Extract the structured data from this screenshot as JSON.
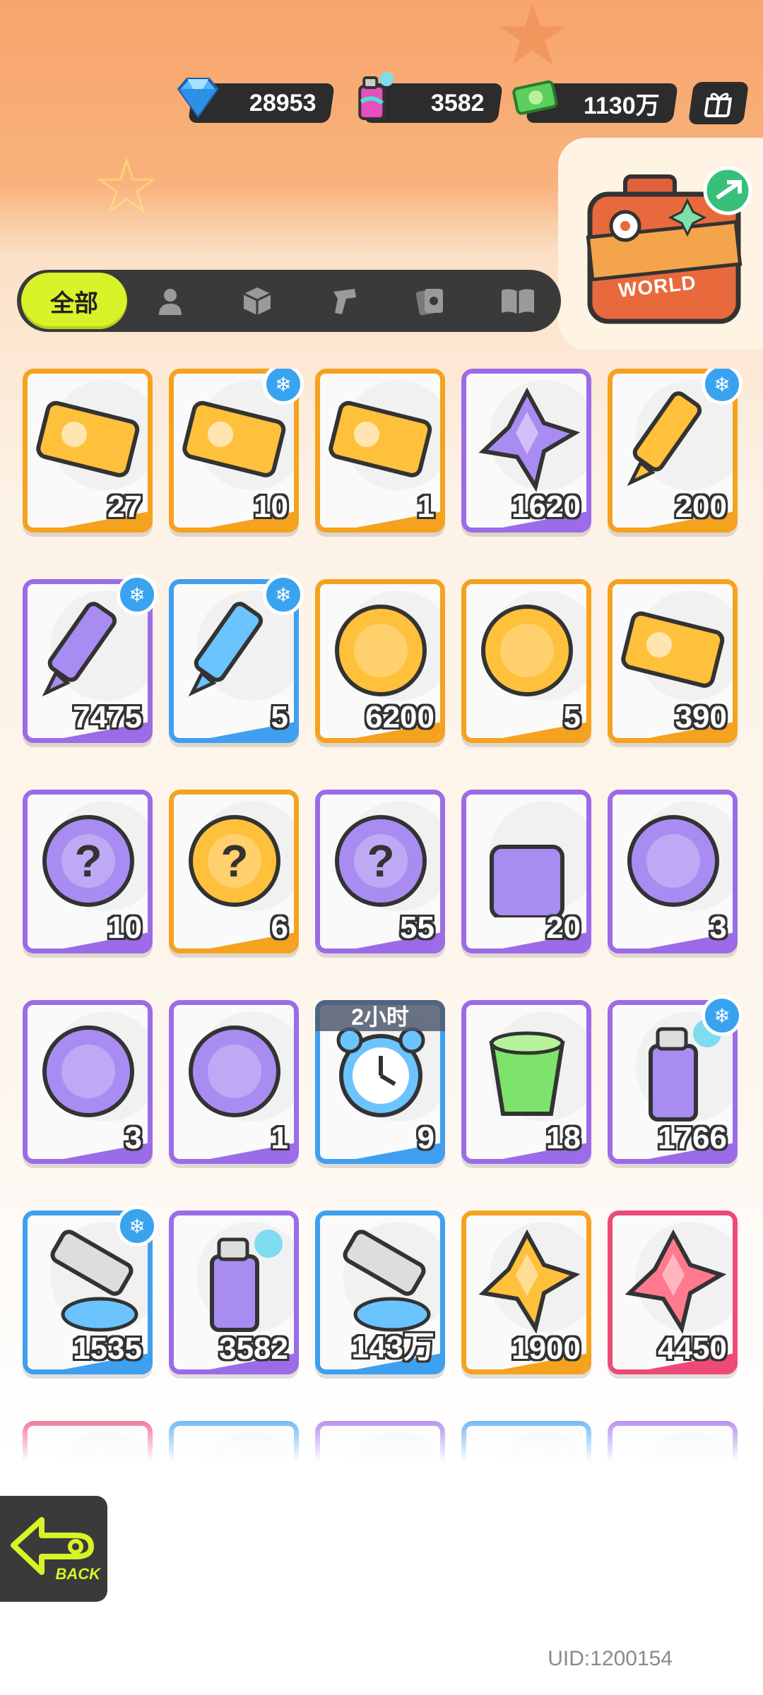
{
  "resources": {
    "diamond": {
      "icon": "diamond-icon",
      "value": "28953"
    },
    "spray": {
      "icon": "spray-can-icon",
      "value": "3582"
    },
    "cash": {
      "icon": "cash-icon",
      "value": "1130万"
    }
  },
  "suitcase": {
    "label": "WORLD"
  },
  "tabs": {
    "all_label": "全部",
    "icons": [
      "person-icon",
      "box-icon",
      "spray-gun-icon",
      "cards-icon",
      "book-icon"
    ]
  },
  "items": [
    {
      "icon": "gold-ticket-icon",
      "count": "27",
      "color": "orange",
      "badge": false
    },
    {
      "icon": "wave-up-ticket-icon",
      "count": "10",
      "color": "orange",
      "badge": true
    },
    {
      "icon": "purple-ticket-icon",
      "count": "1",
      "color": "orange",
      "badge": false
    },
    {
      "icon": "blue-star-crystal-icon",
      "count": "1620",
      "color": "purple",
      "badge": false
    },
    {
      "icon": "gold-crayon-icon",
      "count": "200",
      "color": "orange",
      "badge": true
    },
    {
      "icon": "purple-crayon-icon",
      "count": "7475",
      "color": "purple",
      "badge": true
    },
    {
      "icon": "blue-crayon-icon",
      "count": "5",
      "color": "blue",
      "badge": true
    },
    {
      "icon": "cool-sticker-icon",
      "count": "6200",
      "color": "orange",
      "badge": false
    },
    {
      "icon": "star-burst-sticker-icon",
      "count": "5",
      "color": "orange",
      "badge": false
    },
    {
      "icon": "season-ticket-icon",
      "count": "390",
      "color": "orange",
      "badge": false
    },
    {
      "icon": "mystery-egg-icon",
      "count": "10",
      "color": "purple",
      "badge": false
    },
    {
      "icon": "gold-mystery-badge-icon",
      "count": "6",
      "color": "orange",
      "badge": false
    },
    {
      "icon": "purple-mystery-badge-icon",
      "count": "55",
      "color": "purple",
      "badge": false
    },
    {
      "icon": "travel-card-mystery-icon",
      "count": "20",
      "color": "purple",
      "badge": false
    },
    {
      "icon": "red-fish-orb-icon",
      "count": "3",
      "color": "purple",
      "badge": false
    },
    {
      "icon": "yellow-creature-orb-icon",
      "count": "3",
      "color": "purple",
      "badge": false
    },
    {
      "icon": "green-sprout-orb-icon",
      "count": "1",
      "color": "purple",
      "badge": false
    },
    {
      "icon": "alarm-clock-icon",
      "count": "9",
      "color": "blue",
      "badge": false,
      "timer": "2小时"
    },
    {
      "icon": "green-drink-icon",
      "count": "18",
      "color": "purple",
      "badge": false
    },
    {
      "icon": "blue-spray-can-icon",
      "count": "1766",
      "color": "purple",
      "badge": true
    },
    {
      "icon": "rainbow-paint-tube-icon",
      "count": "1535",
      "color": "blue",
      "badge": true
    },
    {
      "icon": "pink-spray-can-icon",
      "count": "3582",
      "color": "purple",
      "badge": false
    },
    {
      "icon": "paint-tube-icon",
      "count": "143万",
      "color": "blue",
      "badge": false
    },
    {
      "icon": "gold-gem-icon",
      "count": "1900",
      "color": "orange",
      "badge": false
    },
    {
      "icon": "red-gem-icon",
      "count": "4450",
      "color": "pink",
      "badge": false
    },
    {
      "icon": "partial-item-icon",
      "count": "",
      "color": "pink",
      "badge": false
    },
    {
      "icon": "partial-item-icon",
      "count": "",
      "color": "blue",
      "badge": false
    },
    {
      "icon": "partial-item-icon",
      "count": "",
      "color": "purple",
      "badge": false
    },
    {
      "icon": "partial-item-icon",
      "count": "",
      "color": "blue",
      "badge": false
    },
    {
      "icon": "partial-item-icon",
      "count": "",
      "color": "purple",
      "badge": false
    }
  ],
  "back": {
    "label": "BACK"
  },
  "uid": "UID:1200154",
  "colors": {
    "accent": "#d8f327",
    "orange": "#f5a21f",
    "purple": "#9c6be8",
    "blue": "#3f9ff0",
    "pink": "#ee4a78"
  }
}
